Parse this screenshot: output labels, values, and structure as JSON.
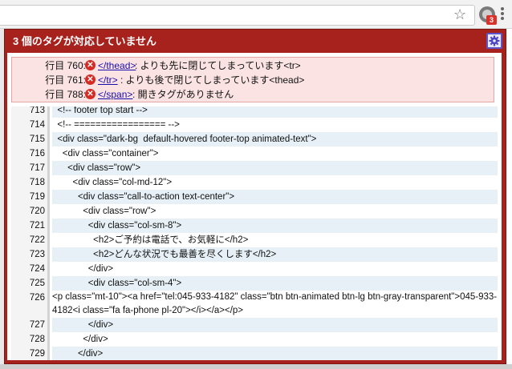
{
  "browser": {
    "extension_badge": "3"
  },
  "popup": {
    "title": "3 個のタグが対応していません",
    "errors": [
      {
        "location": "行目 760:",
        "tag": "</thead>",
        "message": ": よりも先に閉じてしまっています<tr>"
      },
      {
        "location": "行目 761:",
        "tag": "</tr>",
        "message": ": よりも後で閉じてしまっています<thead>"
      },
      {
        "location": "行目 788:",
        "tag": "</span>",
        "message": ": 開きタグがありません"
      }
    ],
    "source_lines": [
      {
        "num": "713",
        "code": "  <!-- footer top start -->"
      },
      {
        "num": "714",
        "code": "  <!-- ================= -->"
      },
      {
        "num": "715",
        "code": "  <div class=\"dark-bg  default-hovered footer-top animated-text\">"
      },
      {
        "num": "716",
        "code": "    <div class=\"container\">"
      },
      {
        "num": "717",
        "code": "      <div class=\"row\">"
      },
      {
        "num": "718",
        "code": "        <div class=\"col-md-12\">"
      },
      {
        "num": "719",
        "code": "          <div class=\"call-to-action text-center\">"
      },
      {
        "num": "720",
        "code": "            <div class=\"row\">"
      },
      {
        "num": "721",
        "code": "              <div class=\"col-sm-8\">"
      },
      {
        "num": "722",
        "code": "                <h2>ご予約は電話で、お気軽に</h2>"
      },
      {
        "num": "723",
        "code": "                <h2>どんな状況でも最善を尽くします</h2>"
      },
      {
        "num": "724",
        "code": "              </div>"
      },
      {
        "num": "725",
        "code": "              <div class=\"col-sm-4\">"
      },
      {
        "num": "726",
        "code": "                <p class=\"mt-10\"><a href=\"tel:045-933-4182\" class=\"btn btn-animated btn-lg btn-gray-transparent\">045-933-4182<i class=\"fa fa-phone pl-20\"></i></a></p>"
      },
      {
        "num": "727",
        "code": "              </div>"
      },
      {
        "num": "728",
        "code": "            </div>"
      },
      {
        "num": "729",
        "code": "          </div>"
      }
    ]
  }
}
